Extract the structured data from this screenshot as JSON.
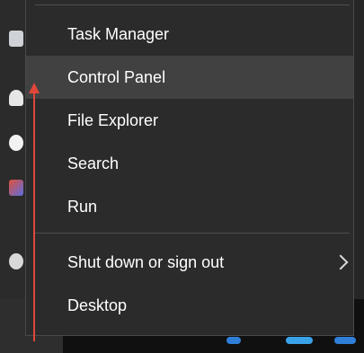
{
  "menu": {
    "items": [
      {
        "label": "Task Manager"
      },
      {
        "label": "Control Panel"
      },
      {
        "label": "File Explorer"
      },
      {
        "label": "Search"
      },
      {
        "label": "Run"
      },
      {
        "label": "Shut down or sign out"
      },
      {
        "label": "Desktop"
      }
    ],
    "hovered_item": "Control Panel"
  },
  "annotation": {
    "arrow_color": "#e0473a"
  },
  "colors": {
    "menu_background": "#2b2b2b",
    "hover_background": "#414141",
    "text": "#ffffff",
    "separator": "#4d4d4d"
  },
  "icons": {
    "submenu": "chevron-right-icon"
  }
}
